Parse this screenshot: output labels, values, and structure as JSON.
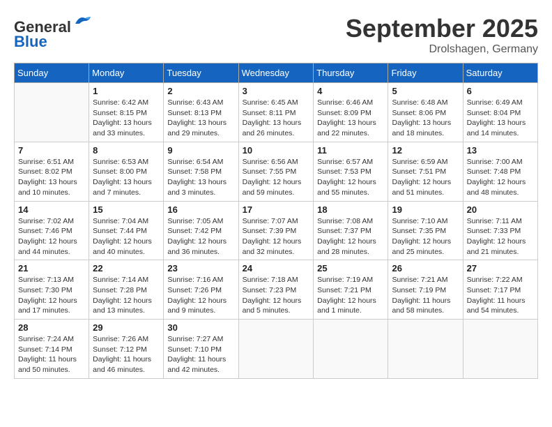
{
  "header": {
    "logo_general": "General",
    "logo_blue": "Blue",
    "month_title": "September 2025",
    "location": "Drolshagen, Germany"
  },
  "weekdays": [
    "Sunday",
    "Monday",
    "Tuesday",
    "Wednesday",
    "Thursday",
    "Friday",
    "Saturday"
  ],
  "weeks": [
    [
      {
        "day": "",
        "info": ""
      },
      {
        "day": "1",
        "info": "Sunrise: 6:42 AM\nSunset: 8:15 PM\nDaylight: 13 hours\nand 33 minutes."
      },
      {
        "day": "2",
        "info": "Sunrise: 6:43 AM\nSunset: 8:13 PM\nDaylight: 13 hours\nand 29 minutes."
      },
      {
        "day": "3",
        "info": "Sunrise: 6:45 AM\nSunset: 8:11 PM\nDaylight: 13 hours\nand 26 minutes."
      },
      {
        "day": "4",
        "info": "Sunrise: 6:46 AM\nSunset: 8:09 PM\nDaylight: 13 hours\nand 22 minutes."
      },
      {
        "day": "5",
        "info": "Sunrise: 6:48 AM\nSunset: 8:06 PM\nDaylight: 13 hours\nand 18 minutes."
      },
      {
        "day": "6",
        "info": "Sunrise: 6:49 AM\nSunset: 8:04 PM\nDaylight: 13 hours\nand 14 minutes."
      }
    ],
    [
      {
        "day": "7",
        "info": "Sunrise: 6:51 AM\nSunset: 8:02 PM\nDaylight: 13 hours\nand 10 minutes."
      },
      {
        "day": "8",
        "info": "Sunrise: 6:53 AM\nSunset: 8:00 PM\nDaylight: 13 hours\nand 7 minutes."
      },
      {
        "day": "9",
        "info": "Sunrise: 6:54 AM\nSunset: 7:58 PM\nDaylight: 13 hours\nand 3 minutes."
      },
      {
        "day": "10",
        "info": "Sunrise: 6:56 AM\nSunset: 7:55 PM\nDaylight: 12 hours\nand 59 minutes."
      },
      {
        "day": "11",
        "info": "Sunrise: 6:57 AM\nSunset: 7:53 PM\nDaylight: 12 hours\nand 55 minutes."
      },
      {
        "day": "12",
        "info": "Sunrise: 6:59 AM\nSunset: 7:51 PM\nDaylight: 12 hours\nand 51 minutes."
      },
      {
        "day": "13",
        "info": "Sunrise: 7:00 AM\nSunset: 7:48 PM\nDaylight: 12 hours\nand 48 minutes."
      }
    ],
    [
      {
        "day": "14",
        "info": "Sunrise: 7:02 AM\nSunset: 7:46 PM\nDaylight: 12 hours\nand 44 minutes."
      },
      {
        "day": "15",
        "info": "Sunrise: 7:04 AM\nSunset: 7:44 PM\nDaylight: 12 hours\nand 40 minutes."
      },
      {
        "day": "16",
        "info": "Sunrise: 7:05 AM\nSunset: 7:42 PM\nDaylight: 12 hours\nand 36 minutes."
      },
      {
        "day": "17",
        "info": "Sunrise: 7:07 AM\nSunset: 7:39 PM\nDaylight: 12 hours\nand 32 minutes."
      },
      {
        "day": "18",
        "info": "Sunrise: 7:08 AM\nSunset: 7:37 PM\nDaylight: 12 hours\nand 28 minutes."
      },
      {
        "day": "19",
        "info": "Sunrise: 7:10 AM\nSunset: 7:35 PM\nDaylight: 12 hours\nand 25 minutes."
      },
      {
        "day": "20",
        "info": "Sunrise: 7:11 AM\nSunset: 7:33 PM\nDaylight: 12 hours\nand 21 minutes."
      }
    ],
    [
      {
        "day": "21",
        "info": "Sunrise: 7:13 AM\nSunset: 7:30 PM\nDaylight: 12 hours\nand 17 minutes."
      },
      {
        "day": "22",
        "info": "Sunrise: 7:14 AM\nSunset: 7:28 PM\nDaylight: 12 hours\nand 13 minutes."
      },
      {
        "day": "23",
        "info": "Sunrise: 7:16 AM\nSunset: 7:26 PM\nDaylight: 12 hours\nand 9 minutes."
      },
      {
        "day": "24",
        "info": "Sunrise: 7:18 AM\nSunset: 7:23 PM\nDaylight: 12 hours\nand 5 minutes."
      },
      {
        "day": "25",
        "info": "Sunrise: 7:19 AM\nSunset: 7:21 PM\nDaylight: 12 hours\nand 1 minute."
      },
      {
        "day": "26",
        "info": "Sunrise: 7:21 AM\nSunset: 7:19 PM\nDaylight: 11 hours\nand 58 minutes."
      },
      {
        "day": "27",
        "info": "Sunrise: 7:22 AM\nSunset: 7:17 PM\nDaylight: 11 hours\nand 54 minutes."
      }
    ],
    [
      {
        "day": "28",
        "info": "Sunrise: 7:24 AM\nSunset: 7:14 PM\nDaylight: 11 hours\nand 50 minutes."
      },
      {
        "day": "29",
        "info": "Sunrise: 7:26 AM\nSunset: 7:12 PM\nDaylight: 11 hours\nand 46 minutes."
      },
      {
        "day": "30",
        "info": "Sunrise: 7:27 AM\nSunset: 7:10 PM\nDaylight: 11 hours\nand 42 minutes."
      },
      {
        "day": "",
        "info": ""
      },
      {
        "day": "",
        "info": ""
      },
      {
        "day": "",
        "info": ""
      },
      {
        "day": "",
        "info": ""
      }
    ]
  ]
}
